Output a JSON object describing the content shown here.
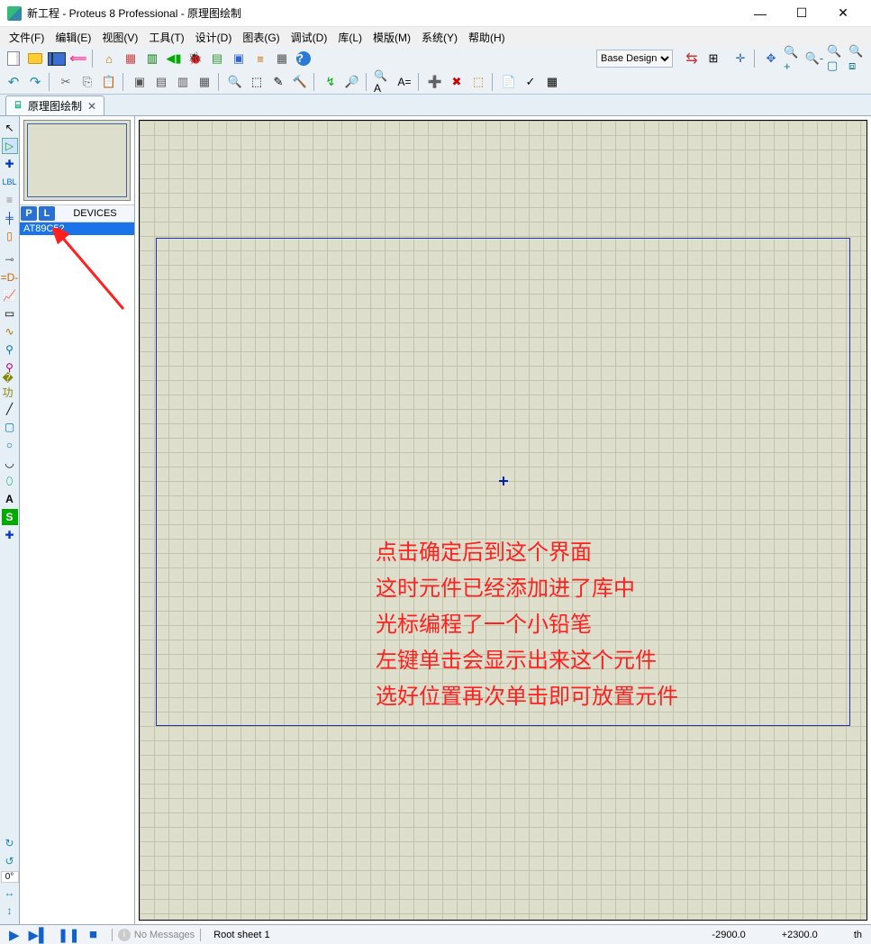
{
  "titlebar": {
    "title": "新工程 - Proteus 8 Professional - 原理图绘制",
    "min": "—",
    "max": "☐",
    "close": "✕"
  },
  "menubar": [
    "文件(F)",
    "编辑(E)",
    "视图(V)",
    "工具(T)",
    "设计(D)",
    "图表(G)",
    "调试(D)",
    "库(L)",
    "模版(M)",
    "系统(Y)",
    "帮助(H)"
  ],
  "design_selector": {
    "value": "Base Design"
  },
  "tab": {
    "label": "原理图绘制",
    "close": "✕"
  },
  "devices": {
    "p": "P",
    "l": "L",
    "header": "DEVICES",
    "items": [
      "AT89C52"
    ]
  },
  "rotation_angle": "0°",
  "annotation": {
    "l1": "点击确定后到这个界面",
    "l2": "这时元件已经添加进了库中",
    "l3": "光标编程了一个小铅笔",
    "l4": "左键单击会显示出来这个元件",
    "l5": "选好位置再次单击即可放置元件"
  },
  "statusbar": {
    "play": "▶",
    "step": "▶▌",
    "pause": "❚❚",
    "stop": "■",
    "msgicon": "i",
    "messages": "No Messages",
    "sheet": "Root sheet 1",
    "x": "-2900.0",
    "y": "+2300.0",
    "unit": "th"
  }
}
